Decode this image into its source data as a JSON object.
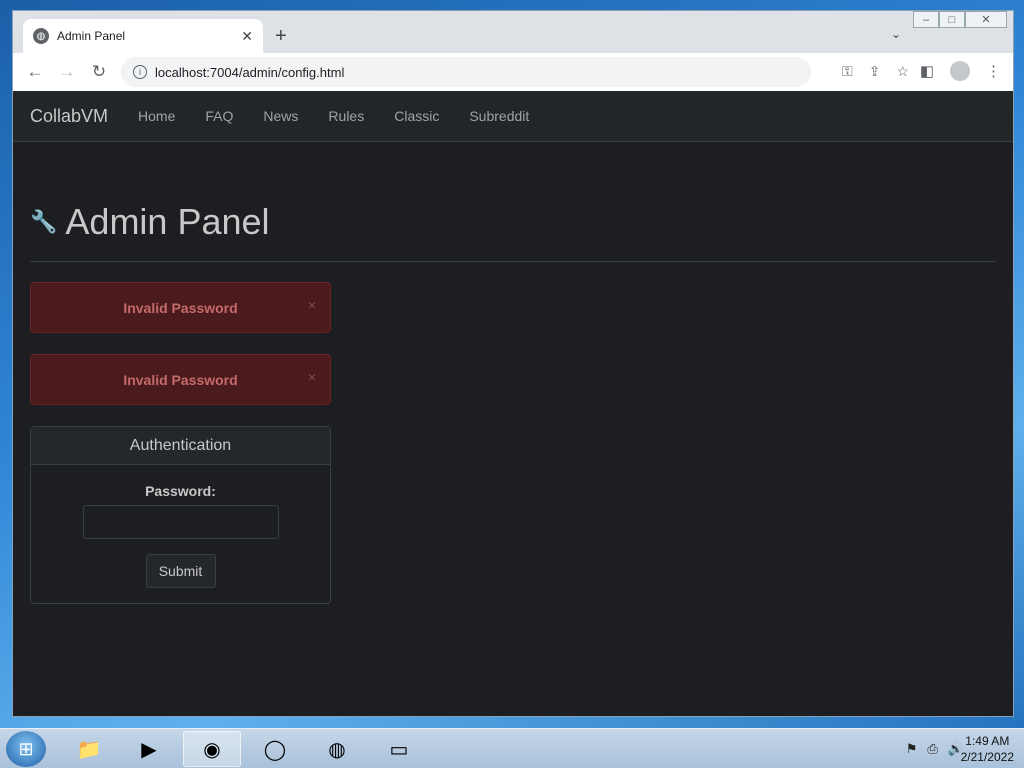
{
  "browser": {
    "tab_title": "Admin Panel",
    "url": "localhost:7004/admin/config.html",
    "new_tab_symbol": "+",
    "tab_close_symbol": "✕",
    "win_minimize": "–",
    "win_maximize": "□",
    "win_close": "✕"
  },
  "navbar": {
    "brand": "CollabVM",
    "links": [
      "Home",
      "FAQ",
      "News",
      "Rules",
      "Classic",
      "Subreddit"
    ]
  },
  "page": {
    "heading": "Admin Panel",
    "alerts": [
      {
        "message": "Invalid Password",
        "close": "×"
      },
      {
        "message": "Invalid Password",
        "close": "×"
      }
    ],
    "auth_panel": {
      "title": "Authentication",
      "password_label": "Password:",
      "password_value": "",
      "submit_label": "Submit"
    }
  },
  "taskbar": {
    "time": "1:49 AM",
    "date": "2/21/2022"
  }
}
